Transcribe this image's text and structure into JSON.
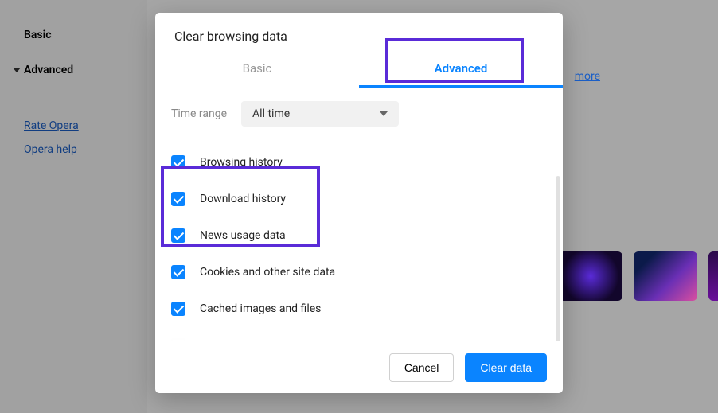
{
  "sidebar": {
    "basic": "Basic",
    "advanced": "Advanced",
    "links": [
      "Rate Opera",
      "Opera help"
    ]
  },
  "more_link": "more",
  "modal": {
    "title": "Clear browsing data",
    "tabs": {
      "basic": "Basic",
      "advanced": "Advanced",
      "active": "advanced"
    },
    "time_label": "Time range",
    "time_value": "All time",
    "options": [
      {
        "label": "Browsing history",
        "checked": true
      },
      {
        "label": "Download history",
        "checked": true
      },
      {
        "label": "News usage data",
        "checked": true
      },
      {
        "label": "Cookies and other site data",
        "checked": true
      },
      {
        "label": "Cached images and files",
        "checked": true
      }
    ],
    "cancel": "Cancel",
    "clear": "Clear data"
  }
}
